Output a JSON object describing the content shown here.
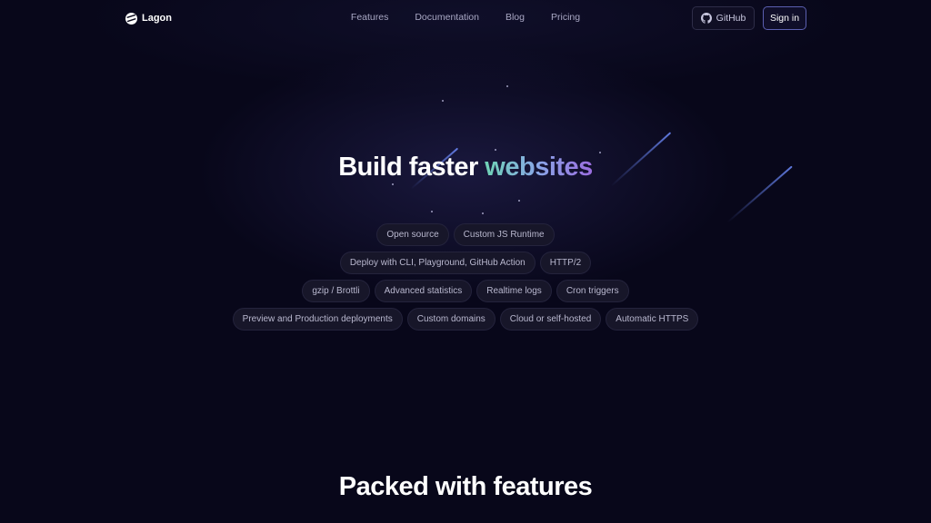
{
  "brand": {
    "name": "Lagon",
    "logo_icon": "lagon-logo-icon"
  },
  "nav": {
    "links": [
      "Features",
      "Documentation",
      "Blog",
      "Pricing"
    ],
    "github_label": "GitHub",
    "github_icon": "github-icon",
    "signin_label": "Sign in"
  },
  "hero": {
    "title_plain": "Build faster",
    "title_highlight": "websites",
    "tag_rows": [
      [
        "Open source",
        "Custom JS Runtime"
      ],
      [
        "Deploy with CLI, Playground, GitHub Action",
        "HTTP/2"
      ],
      [
        "gzip / Brottli",
        "Advanced statistics",
        "Realtime logs",
        "Cron triggers"
      ],
      [
        "Preview and Production deployments",
        "Custom domains",
        "Cloud or self-hosted",
        "Automatic HTTPS"
      ]
    ]
  },
  "features": {
    "title": "Packed with features"
  },
  "colors": {
    "background": "#08071a",
    "gradient_start": "#6fd3b5",
    "gradient_end": "#9b6de0",
    "signin_border": "#5b5fb0"
  }
}
